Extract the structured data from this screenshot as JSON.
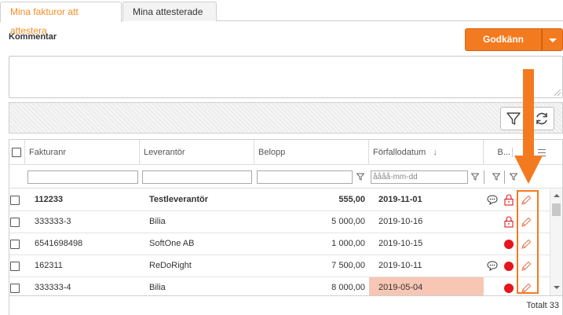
{
  "tabs": [
    {
      "label": "Mina fakturor att attestera",
      "active": true
    },
    {
      "label": "Mina attesterade",
      "active": false
    }
  ],
  "comment": {
    "label": "Kommentar",
    "value": ""
  },
  "approve_button": {
    "label": "Godkänn",
    "dropdown_icon": "caret-down-icon"
  },
  "toolbar": {
    "filter_icon": "filter-icon",
    "refresh_icon": "refresh-icon"
  },
  "grid": {
    "columns": [
      "Fakturanr",
      "Leverantör",
      "Belopp",
      "Förfallodatum",
      "B..."
    ],
    "sort_indicator": "↓",
    "date_placeholder": "åååå-mm-dd",
    "rows": [
      {
        "nr": "112233",
        "supplier": "Testleverantör",
        "amount": "555,00",
        "due": "2019-11-01",
        "bold": true,
        "comment_icon": true,
        "lock_icon": true,
        "red_dot": false,
        "overdue": false
      },
      {
        "nr": "333333-3",
        "supplier": "Bilia",
        "amount": "5 000,00",
        "due": "2019-10-16",
        "bold": false,
        "comment_icon": false,
        "lock_icon": true,
        "red_dot": false,
        "overdue": false
      },
      {
        "nr": "6541698498",
        "supplier": "SoftOne AB",
        "amount": "1 000,00",
        "due": "2019-10-15",
        "bold": false,
        "comment_icon": false,
        "lock_icon": false,
        "red_dot": true,
        "overdue": false
      },
      {
        "nr": "162311",
        "supplier": "ReDoRight",
        "amount": "7 500,00",
        "due": "2019-10-11",
        "bold": false,
        "comment_icon": true,
        "lock_icon": false,
        "red_dot": true,
        "overdue": false
      },
      {
        "nr": "333333-4",
        "supplier": "Bilia",
        "amount": "8 000,00",
        "due": "2019-05-04",
        "bold": false,
        "comment_icon": false,
        "lock_icon": false,
        "red_dot": true,
        "overdue": true
      }
    ],
    "total": "Totalt 33"
  },
  "colors": {
    "accent": "#f47a1f",
    "active_tab": "#f28c28",
    "status_red": "#e4151d",
    "overdue_bg": "#f8c6b5"
  }
}
